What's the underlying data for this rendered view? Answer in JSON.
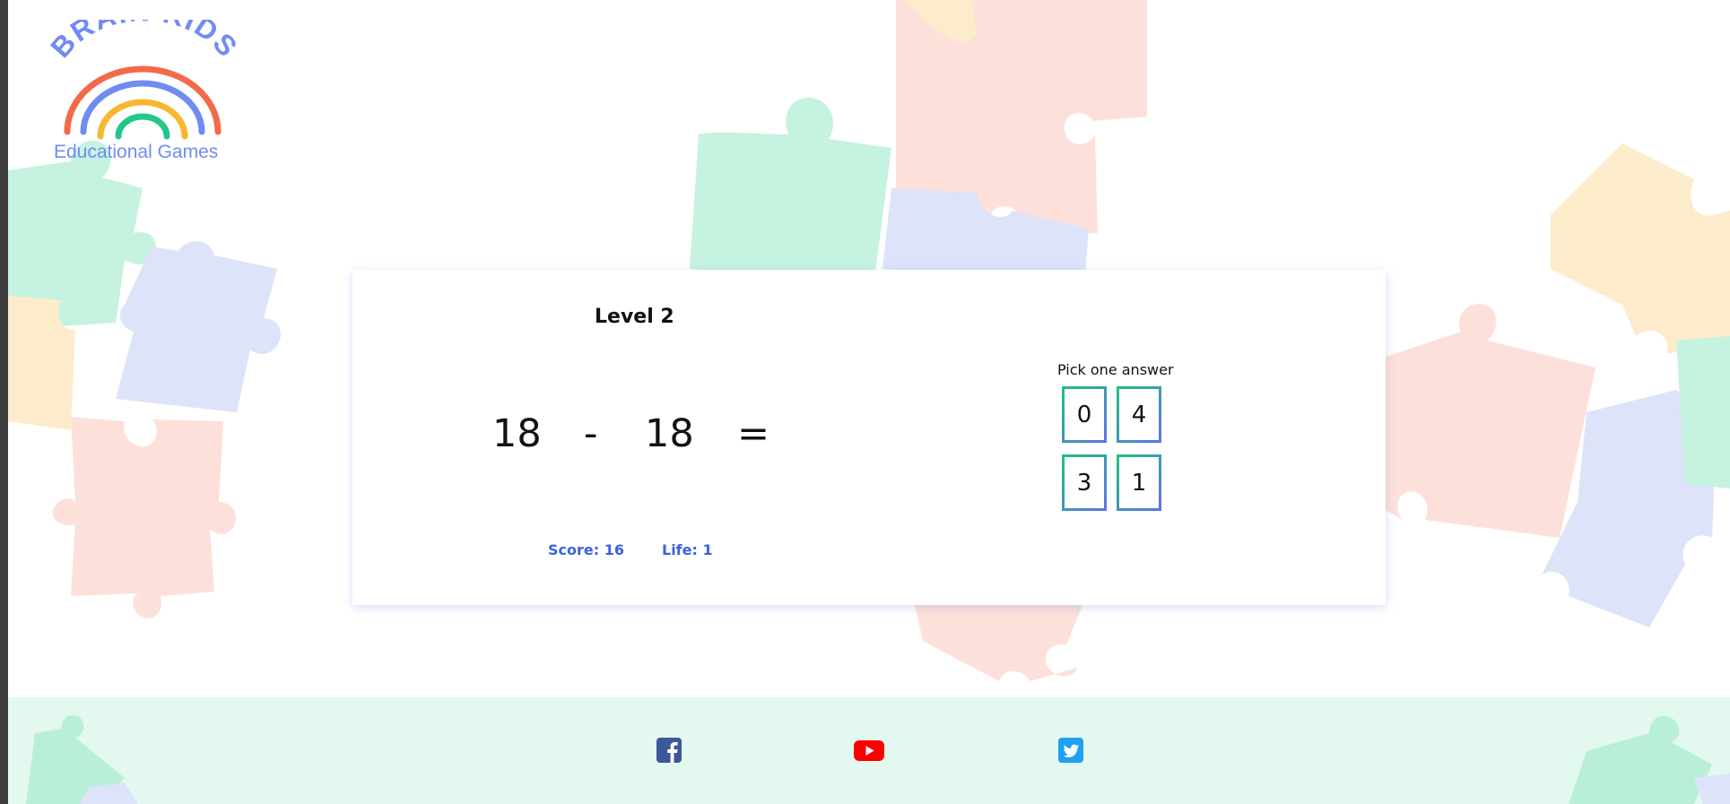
{
  "logo": {
    "brand": "BRAIN KIDS",
    "subtitle": "Educational Games",
    "colors": [
      "#6f8cf2",
      "#f26a4a",
      "#f7b731",
      "#22c78a"
    ]
  },
  "game": {
    "level_label": "Level 2",
    "equation": {
      "left": "18",
      "operator": "-",
      "right": "18",
      "equals": "="
    },
    "prompt": "Pick one answer",
    "answers": [
      "0",
      "4",
      "3",
      "1"
    ],
    "score_label": "Score: 16",
    "life_label": "Life: 1"
  },
  "footer": {
    "icons": [
      "facebook-icon",
      "youtube-icon",
      "twitter-icon"
    ],
    "colors": {
      "facebook": "#3b5998",
      "youtube": "#ff0000",
      "twitter": "#1da1f2"
    }
  },
  "theme": {
    "accent": "#3b62e0",
    "puzzle_colors": [
      "#c6f2e0",
      "#dde3f8",
      "#fde0d9",
      "#fdeccb"
    ]
  }
}
